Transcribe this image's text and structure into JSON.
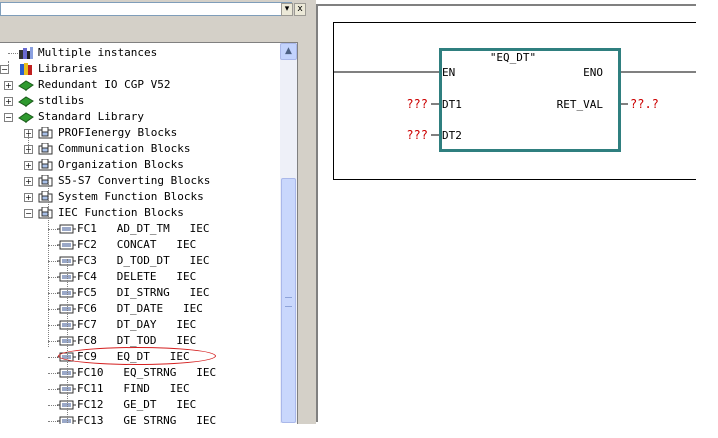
{
  "toolbar": {
    "dropdown_glyph": "▾",
    "close_glyph": "x"
  },
  "tree": {
    "nodes": [
      {
        "label": "Multiple instances",
        "icon": "multiple-instances-icon",
        "expander": ""
      },
      {
        "label": "Libraries",
        "icon": "libraries-icon",
        "expander": "−"
      },
      {
        "label": "Redundant IO CGP V52",
        "icon": "library-book-icon",
        "expander": "+"
      },
      {
        "label": "stdlibs",
        "icon": "library-book-icon",
        "expander": "+"
      },
      {
        "label": "Standard Library",
        "icon": "library-book-icon",
        "expander": "−"
      },
      {
        "label": "PROFIenergy Blocks",
        "icon": "block-folder-icon",
        "expander": "+"
      },
      {
        "label": "Communication Blocks",
        "icon": "block-folder-icon",
        "expander": "+"
      },
      {
        "label": "Organization Blocks",
        "icon": "block-folder-icon",
        "expander": "+"
      },
      {
        "label": "S5-S7 Converting Blocks",
        "icon": "block-folder-icon",
        "expander": "+"
      },
      {
        "label": "System Function Blocks",
        "icon": "block-folder-icon",
        "expander": "+"
      },
      {
        "label": "IEC Function Blocks",
        "icon": "block-folder-icon",
        "expander": "−"
      },
      {
        "label": "FC1   AD_DT_TM   IEC",
        "icon": "function-block-icon",
        "expander": ""
      },
      {
        "label": "FC2   CONCAT   IEC",
        "icon": "function-block-icon",
        "expander": ""
      },
      {
        "label": "FC3   D_TOD_DT   IEC",
        "icon": "function-block-icon",
        "expander": ""
      },
      {
        "label": "FC4   DELETE   IEC",
        "icon": "function-block-icon",
        "expander": ""
      },
      {
        "label": "FC5   DI_STRNG   IEC",
        "icon": "function-block-icon",
        "expander": ""
      },
      {
        "label": "FC6   DT_DATE   IEC",
        "icon": "function-block-icon",
        "expander": ""
      },
      {
        "label": "FC7   DT_DAY   IEC",
        "icon": "function-block-icon",
        "expander": ""
      },
      {
        "label": "FC8   DT_TOD   IEC",
        "icon": "function-block-icon",
        "expander": ""
      },
      {
        "label": "FC9   EQ_DT   IEC",
        "icon": "function-block-icon",
        "expander": "",
        "highlighted": true
      },
      {
        "label": "FC10   EQ_STRNG   IEC",
        "icon": "function-block-icon",
        "expander": ""
      },
      {
        "label": "FC11   FIND   IEC",
        "icon": "function-block-icon",
        "expander": ""
      },
      {
        "label": "FC12   GE_DT   IEC",
        "icon": "function-block-icon",
        "expander": ""
      },
      {
        "label": "FC13   GE_STRNG   IEC",
        "icon": "function-block-icon",
        "expander": ""
      }
    ],
    "scroll_up_glyph": "▲"
  },
  "lad": {
    "block_title": "\"EQ_DT\"",
    "en": "EN",
    "eno": "ENO",
    "in1": "DT1",
    "in2": "DT2",
    "out": "RET_VAL",
    "in1_operand": "???",
    "in2_operand": "???",
    "out_operand": "??.?"
  },
  "colors": {
    "block_border": "#2f7f7f",
    "operand_red": "#cc0000",
    "highlight_ellipse": "#d42020",
    "book_green": "#2f9a2f"
  }
}
